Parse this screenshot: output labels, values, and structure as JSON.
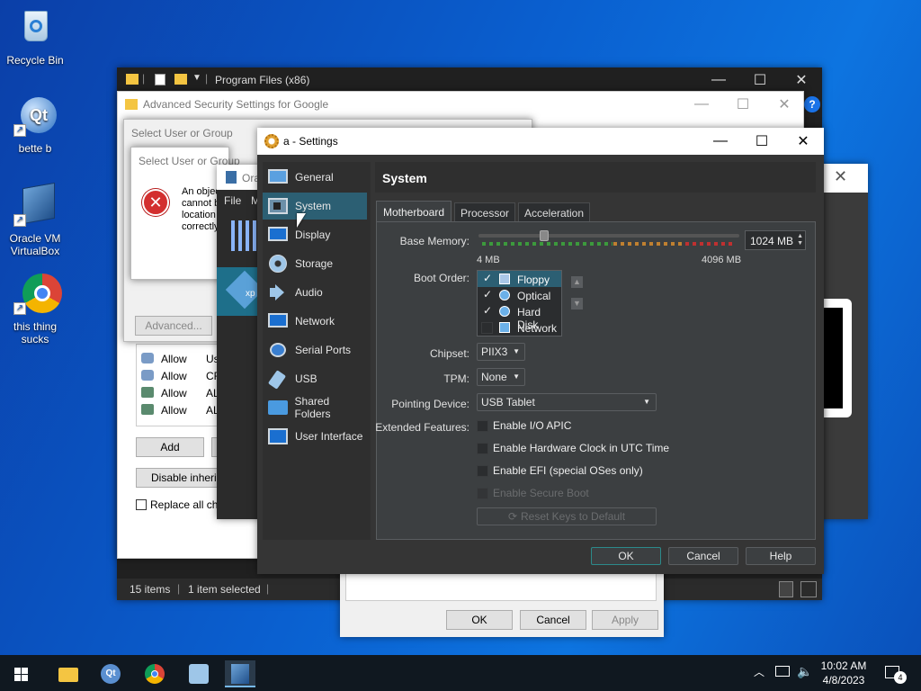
{
  "desktop": {
    "icons": [
      {
        "label": "Recycle Bin"
      },
      {
        "label": "bette b"
      },
      {
        "label": "Oracle VM VirtualBox"
      },
      {
        "label": "this thing sucks"
      }
    ]
  },
  "explorer": {
    "title": "Program Files (x86)",
    "status_items": "15 items",
    "status_selected": "1 item selected"
  },
  "adv_security": {
    "title": "Advanced Security Settings for Google",
    "select_user": "Select User or Group",
    "select_user_inner": "Select User or Group",
    "error_text": "An object\ncannot b\nlocation\ncorrectly",
    "advanced_btn": "Advanced...",
    "add_btn": "Add",
    "disable_inherit_btn": "Disable inherit",
    "replace_all": "Replace all chi",
    "entries": [
      {
        "type": "Allow",
        "principal": "Us"
      },
      {
        "type": "Allow",
        "principal": "CR"
      },
      {
        "type": "Allow",
        "principal": "AL"
      },
      {
        "type": "Allow",
        "principal": "AL"
      }
    ]
  },
  "vbox_manager": {
    "title": "Ora",
    "menu_file": "File",
    "menu_m": "M",
    "vm_label": "xp"
  },
  "properties_dialog": {
    "ok": "OK",
    "cancel": "Cancel",
    "apply": "Apply"
  },
  "settings": {
    "title": "a - Settings",
    "nav": [
      {
        "label": "General",
        "icon": "monitor-icon"
      },
      {
        "label": "System",
        "icon": "chip-icon"
      },
      {
        "label": "Display",
        "icon": "display-icon"
      },
      {
        "label": "Storage",
        "icon": "disk-icon"
      },
      {
        "label": "Audio",
        "icon": "speaker-icon"
      },
      {
        "label": "Network",
        "icon": "network-icon"
      },
      {
        "label": "Serial Ports",
        "icon": "serial-port-icon"
      },
      {
        "label": "USB",
        "icon": "usb-icon"
      },
      {
        "label": "Shared Folders",
        "icon": "folder-icon"
      },
      {
        "label": "User Interface",
        "icon": "window-icon"
      }
    ],
    "section_title": "System",
    "tabs": [
      "Motherboard",
      "Processor",
      "Acceleration"
    ],
    "base_memory_label": "Base Memory:",
    "base_memory_value": "1024 MB",
    "memory_min": "4 MB",
    "memory_max": "4096 MB",
    "memory_fraction": 0.25,
    "boot_order_label": "Boot Order:",
    "boot_items": [
      {
        "label": "Floppy",
        "checked": true
      },
      {
        "label": "Optical",
        "checked": true
      },
      {
        "label": "Hard Disk",
        "checked": true
      },
      {
        "label": "Network",
        "checked": false
      }
    ],
    "chipset_label": "Chipset:",
    "chipset_value": "PIIX3",
    "tpm_label": "TPM:",
    "tpm_value": "None",
    "pointing_label": "Pointing Device:",
    "pointing_value": "USB Tablet",
    "ext_label": "Extended Features:",
    "features": [
      "Enable I/O APIC",
      "Enable Hardware Clock in UTC Time",
      "Enable EFI (special OSes only)",
      "Enable Secure Boot"
    ],
    "reset_keys": "Reset Keys to Default",
    "ok": "OK",
    "cancel": "Cancel",
    "help": "Help"
  },
  "taskbar": {
    "time": "10:02 AM",
    "date": "4/8/2023",
    "notifications": "4"
  }
}
